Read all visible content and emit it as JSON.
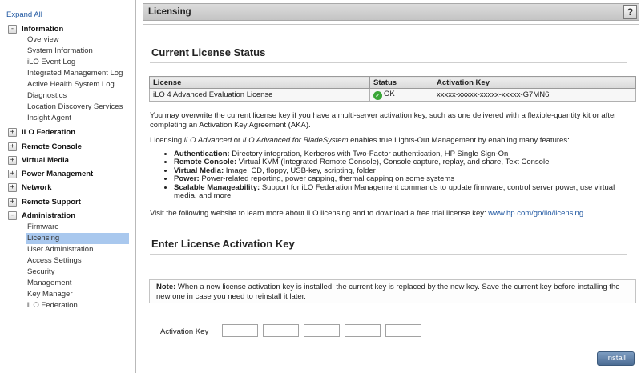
{
  "sidebar": {
    "expand_all": "Expand All",
    "sections": [
      {
        "label": "Information",
        "toggle": "-",
        "items": [
          "Overview",
          "System Information",
          "iLO Event Log",
          "Integrated Management Log",
          "Active Health System Log",
          "Diagnostics",
          "Location Discovery Services",
          "Insight Agent"
        ]
      },
      {
        "label": "iLO Federation",
        "toggle": "+"
      },
      {
        "label": "Remote Console",
        "toggle": "+"
      },
      {
        "label": "Virtual Media",
        "toggle": "+"
      },
      {
        "label": "Power Management",
        "toggle": "+"
      },
      {
        "label": "Network",
        "toggle": "+"
      },
      {
        "label": "Remote Support",
        "toggle": "+"
      },
      {
        "label": "Administration",
        "toggle": "-",
        "items": [
          "Firmware",
          "Licensing",
          "User Administration",
          "Access Settings",
          "Security",
          "Management",
          "Key Manager",
          "iLO Federation"
        ]
      }
    ],
    "selected_item": "Licensing"
  },
  "header": {
    "title": "Licensing",
    "help_label": "?"
  },
  "status_section": {
    "heading": "Current License Status",
    "table": {
      "headers": [
        "License",
        "Status",
        "Activation Key"
      ],
      "rows": [
        {
          "license": "iLO 4 Advanced Evaluation License",
          "status": "OK",
          "key": "xxxxx-xxxxx-xxxxx-xxxxx-G7MN6"
        }
      ]
    },
    "overwrite_text": "You may overwrite the current license key if you have a multi-server activation key, such as one delivered with a flexible-quantity kit or after completing an Activation Key Agreement (AKA).",
    "intro": {
      "prefix": "Licensing ",
      "product1": "iLO Advanced",
      "or": " or ",
      "product2": "iLO Advanced for BladeSystem",
      "suffix": " enables true Lights-Out Management by enabling many features:"
    },
    "features": [
      {
        "title": "Authentication:",
        "text": " Directory integration, Kerberos with Two-Factor authentication, HP Single Sign-On"
      },
      {
        "title": "Remote Console:",
        "text": " Virtual KVM (Integrated Remote Console), Console capture, replay, and share, Text Console"
      },
      {
        "title": "Virtual Media:",
        "text": " Image, CD, floppy, USB-key, scripting, folder"
      },
      {
        "title": "Power:",
        "text": " Power-related reporting, power capping, thermal capping on some systems"
      },
      {
        "title": "Scalable Manageability:",
        "text": " Support for iLO Federation Management commands to update firmware, control server power, use virtual media, and more"
      }
    ],
    "visit_text": "Visit the following website to learn more about iLO licensing and to download a free trial license key: ",
    "visit_link": "www.hp.com/go/ilo/licensing",
    "visit_end": "."
  },
  "activation_section": {
    "heading": "Enter License Activation Key",
    "note_label": "Note:",
    "note_text": " When a new license activation key is installed, the current key is replaced by the new key. Save the current key before installing the new one in case you need to reinstall it later.",
    "key_label": "Activation Key",
    "key_values": [
      "",
      "",
      "",
      "",
      ""
    ],
    "install_label": "Install"
  }
}
